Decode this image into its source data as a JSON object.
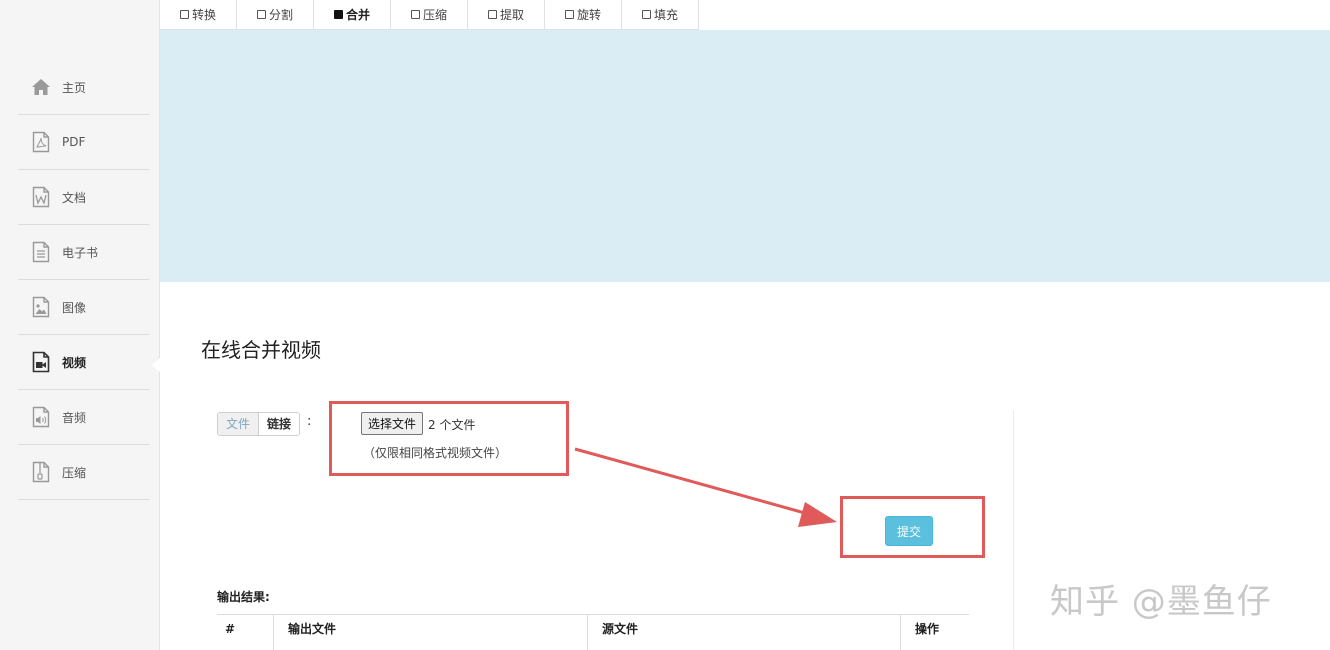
{
  "tabs": [
    {
      "label": "转换",
      "active": false
    },
    {
      "label": "分割",
      "active": false
    },
    {
      "label": "合并",
      "active": true
    },
    {
      "label": "压缩",
      "active": false
    },
    {
      "label": "提取",
      "active": false
    },
    {
      "label": "旋转",
      "active": false
    },
    {
      "label": "填充",
      "active": false
    }
  ],
  "sidebar": {
    "items": [
      {
        "label": "主页",
        "icon": "home-icon",
        "active": false
      },
      {
        "label": "PDF",
        "icon": "pdf-file-icon",
        "active": false
      },
      {
        "label": "文档",
        "icon": "word-file-icon",
        "active": false
      },
      {
        "label": "电子书",
        "icon": "ebook-file-icon",
        "active": false
      },
      {
        "label": "图像",
        "icon": "image-file-icon",
        "active": false
      },
      {
        "label": "视频",
        "icon": "video-file-icon",
        "active": true
      },
      {
        "label": "音频",
        "icon": "audio-file-icon",
        "active": false
      },
      {
        "label": "压缩",
        "icon": "archive-file-icon",
        "active": false
      }
    ]
  },
  "main": {
    "title": "在线合并视频",
    "source_toggle": {
      "file_label": "文件",
      "link_label": "链接",
      "separator": ":"
    },
    "file_input": {
      "button_label": "选择文件",
      "status": "2 个文件",
      "hint": "（仅限相同格式视频文件）"
    },
    "submit_label": "提交",
    "output_label": "输出结果:",
    "table_headers": [
      "#",
      "输出文件",
      "源文件",
      "操作"
    ]
  },
  "watermark": "知乎 @墨鱼仔",
  "colors": {
    "banner": "#daedf5",
    "submit": "#5bc0de",
    "annotation": "#e15a5a"
  }
}
